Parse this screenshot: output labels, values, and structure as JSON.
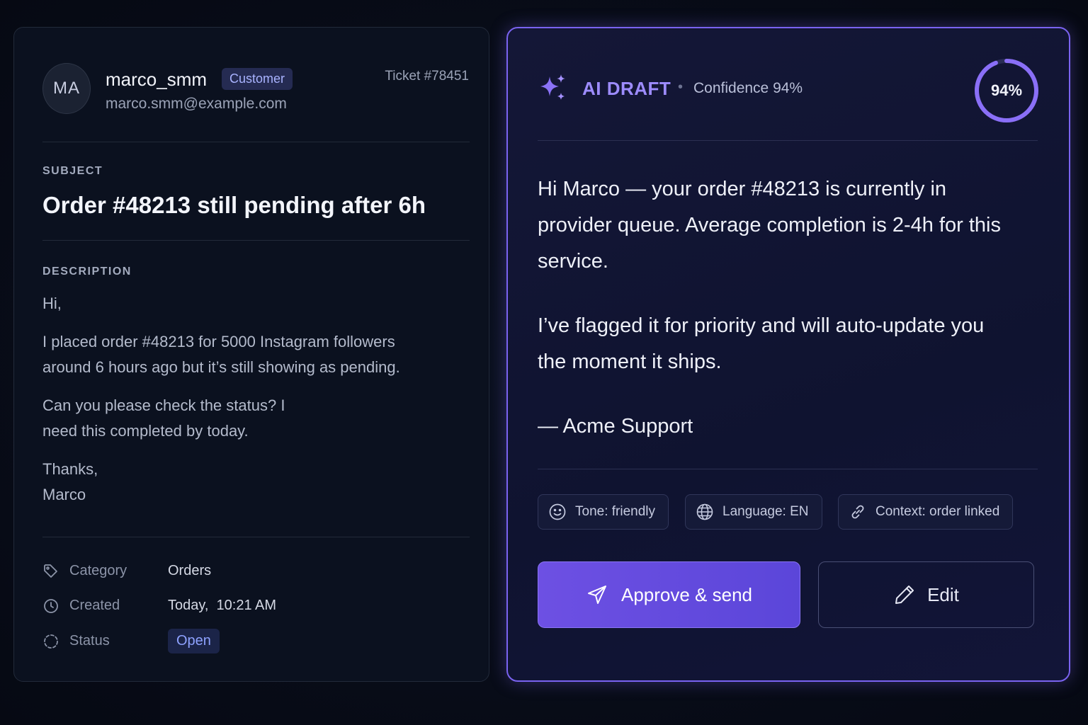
{
  "ticket": {
    "avatar_initials": "MA",
    "sender_name": "marco_smm",
    "role_badge": "Customer",
    "sender_email": "marco.smm@example.com",
    "ticket_id": "Ticket #78451",
    "subject_label": "SUBJECT",
    "subject": "Order #48213 still pending after 6h",
    "description_label": "DESCRIPTION",
    "description": [
      "Hi,",
      "I placed order #48213 for 5000 Instagram followers around 6 hours ago but it’s still showing as pending.",
      "Can you please check the status? I need this completed by today.",
      "Thanks, Marco"
    ],
    "meta": {
      "category_label": "Category",
      "category_value": "Orders",
      "created_label": "Created",
      "created_value": "Today,  10:21 AM",
      "status_label": "Status",
      "status_value": "Open"
    }
  },
  "draft": {
    "title": "AI DRAFT",
    "separator": "•",
    "confidence_label": "Confidence 94%",
    "confidence_percent": 94,
    "confidence_ring_text": "94%",
    "body": [
      "Hi Marco — your order #48213 is currently in provider queue. Average completion is 2-4h for this service.",
      "I’ve flagged it for priority and will auto-update you the moment it ships.",
      "— Acme Support"
    ],
    "chips": {
      "tone": "Tone: friendly",
      "language": "Language: EN",
      "context": "Context: order linked"
    },
    "actions": {
      "approve": "Approve & send",
      "edit": "Edit"
    }
  },
  "colors": {
    "accent": "#7a63f0",
    "badge_bg": "#252b52",
    "status_open": "#8ea2ff",
    "background": "#070b16"
  },
  "icons": [
    "sparkle-icon",
    "tag-icon",
    "clock-icon",
    "status-icon",
    "smile-icon",
    "globe-icon",
    "link-icon",
    "send-icon",
    "pencil-icon"
  ]
}
